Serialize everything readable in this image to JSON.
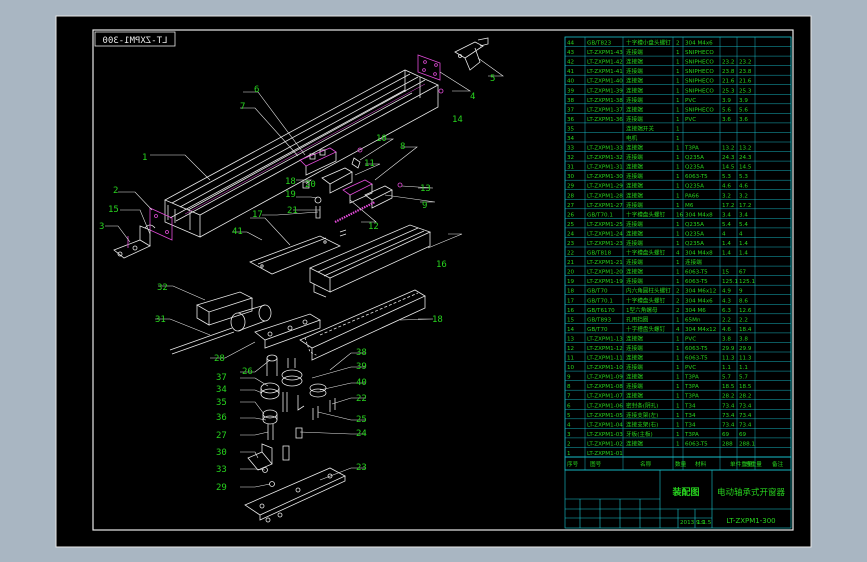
{
  "drawing": {
    "code_mirrored": "LT-ZXPM1-300",
    "code": "LT-ZXPM1-300",
    "title": "装配图",
    "name": "电动轴承式开窗器",
    "scale": "1:1.5",
    "sheet": "2013.9.9"
  },
  "parts_list": {
    "headers": [
      "序号",
      "图号",
      "名称",
      "数量",
      "材料",
      "单件重量",
      "总重量",
      "备注"
    ],
    "rows": [
      [
        "44",
        "GB/T823",
        "十字槽小盘头螺钉",
        "2",
        "304 M4x6",
        "",
        ""
      ],
      [
        "43",
        "LT-ZXPM1-43",
        "连接端",
        "1",
        "SNIPHECO",
        "",
        ""
      ],
      [
        "42",
        "LT-ZXPM1-42",
        "连接端",
        "1",
        "SNIPHECO",
        "23.2",
        "23.2"
      ],
      [
        "41",
        "LT-ZXPM1-41",
        "连接端",
        "1",
        "SNIPHECO",
        "23.8",
        "23.8"
      ],
      [
        "40",
        "LT-ZXPM1-40",
        "连接端",
        "1",
        "SNIPHECO",
        "21.6",
        "21.6"
      ],
      [
        "39",
        "LT-ZXPM1-39",
        "连接端",
        "1",
        "SNIPHECO",
        "25.3",
        "25.3"
      ],
      [
        "38",
        "LT-ZXPM1-38",
        "连接端",
        "1",
        "PVC",
        "3.9",
        "3.9"
      ],
      [
        "37",
        "LT-ZXPM1-37",
        "连接端",
        "1",
        "SNIPHECO",
        "5.6",
        "5.6"
      ],
      [
        "36",
        "LT-ZXPM1-36",
        "连接端",
        "1",
        "PVC",
        "3.6",
        "3.6"
      ],
      [
        "35",
        "",
        "连接端开关",
        "1",
        "",
        "",
        ""
      ],
      [
        "34",
        "",
        "电机",
        "1",
        "",
        "",
        ""
      ],
      [
        "33",
        "LT-ZXPM1-33",
        "连接端",
        "1",
        "T3PA",
        "13.2",
        "13.2"
      ],
      [
        "32",
        "LT-ZXPM1-32",
        "连接端",
        "1",
        "Q235A",
        "24.3",
        "24.3"
      ],
      [
        "31",
        "LT-ZXPM1-31",
        "连接端",
        "1",
        "Q235A",
        "14.5",
        "14.5"
      ],
      [
        "30",
        "LT-ZXPM1-30",
        "连接端",
        "1",
        "6063-T5",
        "5.3",
        "5.3"
      ],
      [
        "29",
        "LT-ZXPM1-29",
        "连接端",
        "1",
        "Q235A",
        "4.6",
        "4.6"
      ],
      [
        "28",
        "LT-ZXPM1-28",
        "连接端",
        "1",
        "PA66",
        "3.2",
        "3.2"
      ],
      [
        "27",
        "LT-ZXPM1-27",
        "连接端",
        "1",
        "M6",
        "17.2",
        "17.2"
      ],
      [
        "26",
        "GB/T70.1",
        "十字槽盘头螺钉",
        "16",
        "304 M4x8",
        "3.4",
        "3.4"
      ],
      [
        "25",
        "LT-ZXPM1-25",
        "连接端",
        "1",
        "Q235A",
        "5.4",
        "5.4"
      ],
      [
        "24",
        "LT-ZXPM1-24",
        "连接端",
        "1",
        "Q235A",
        "4",
        "4"
      ],
      [
        "23",
        "LT-ZXPM1-23",
        "连接端",
        "1",
        "Q235A",
        "1.4",
        "1.4"
      ],
      [
        "22",
        "GB/T818",
        "十字槽盘头螺钉",
        "4",
        "304 M4x8",
        "1.4",
        "1.4"
      ],
      [
        "21",
        "LT-ZXPM1-21",
        "连接端",
        "1",
        "连接端",
        "",
        ""
      ],
      [
        "20",
        "LT-ZXPM1-20",
        "连接端",
        "1",
        "6063-T5",
        "15",
        "67"
      ],
      [
        "19",
        "LT-ZXPM1-19",
        "连接端",
        "1",
        "6063-T5",
        "125.1",
        "125.1"
      ],
      [
        "18",
        "GB/T70",
        "内六角圆柱头螺钉",
        "2",
        "304 M6x12",
        "4.9",
        "9"
      ],
      [
        "17",
        "GB/T70.1",
        "十字槽盘头螺钉",
        "2",
        "304 M4x6",
        "4.3",
        "8.6"
      ],
      [
        "16",
        "GB/T6170",
        "1型六角螺母",
        "2",
        "304 M6",
        "6.3",
        "12.6"
      ],
      [
        "15",
        "GB/T893",
        "孔用挡圈",
        "1",
        "65Mn",
        "2.2",
        "2.2"
      ],
      [
        "14",
        "GB/T70",
        "十字槽盘头螺钉",
        "4",
        "304 M4x12",
        "4.6",
        "18.4"
      ],
      [
        "13",
        "LT-ZXPM1-13",
        "连接端",
        "1",
        "PVC",
        "3.8",
        "3.8"
      ],
      [
        "12",
        "LT-ZXPM1-12",
        "连接端",
        "1",
        "6063-T5",
        "29.9",
        "29.9"
      ],
      [
        "11",
        "LT-ZXPM1-11",
        "连接端",
        "1",
        "6063-T5",
        "11.3",
        "11.3"
      ],
      [
        "10",
        "LT-ZXPM1-10",
        "连接端",
        "1",
        "PVC",
        "1.1",
        "1.1"
      ],
      [
        "9",
        "LT-ZXPM1-09",
        "连接端",
        "1",
        "T3PA",
        "5.7",
        "5.7"
      ],
      [
        "8",
        "LT-ZXPM1-08",
        "连接端",
        "1",
        "T3PA",
        "18.5",
        "18.5"
      ],
      [
        "7",
        "LT-ZXPM1-07",
        "连接端",
        "1",
        "T3PA",
        "28.2",
        "28.2"
      ],
      [
        "6",
        "LT-ZXPM1-06",
        "密封条(阴孔)",
        "1",
        "T34",
        "73.4",
        "73.4"
      ],
      [
        "5",
        "LT-ZXPM1-05",
        "连接支架(左)",
        "1",
        "T34",
        "73.4",
        "73.4"
      ],
      [
        "4",
        "LT-ZXPM1-04",
        "连接支架(右)",
        "1",
        "T34",
        "73.4",
        "73.4"
      ],
      [
        "3",
        "LT-ZXPM1-03",
        "牙板(主板)",
        "1",
        "T3PA",
        "69",
        "69"
      ],
      [
        "2",
        "LT-ZXPM1-02",
        "连接端",
        "1",
        "6063-T5",
        "288",
        "288.1"
      ],
      [
        "1",
        "LT-ZXPM1-01",
        "",
        "",
        "",
        "",
        ""
      ]
    ]
  },
  "callouts": [
    "1",
    "2",
    "3",
    "4",
    "5",
    "6",
    "7",
    "8",
    "9",
    "10",
    "11",
    "12",
    "13",
    "14",
    "15",
    "16",
    "17",
    "18",
    "19",
    "20",
    "21",
    "22",
    "23",
    "24",
    "25",
    "26",
    "27",
    "28",
    "29",
    "30",
    "31",
    "32",
    "33",
    "34",
    "35",
    "36",
    "37",
    "38",
    "39",
    "40",
    "41"
  ],
  "colors": {
    "background": "#a9b6c2",
    "paper": "#000000",
    "frame": "#ffffff",
    "table_lines": "#18c6d2",
    "table_text": "#27d21e",
    "part_lines": "#e8e8e8",
    "accent_parts": "#e24bd9",
    "labels": "#27d21e",
    "leaders": "#e8e8e8"
  }
}
